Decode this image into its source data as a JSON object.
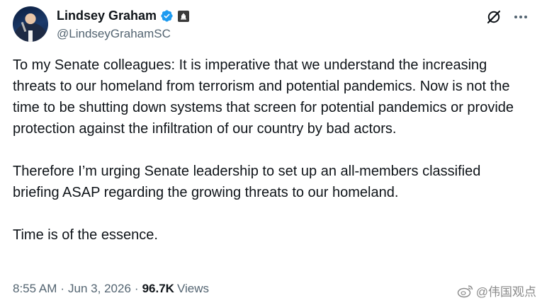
{
  "author": {
    "display_name": "Lindsey Graham",
    "handle": "@LindseyGrahamSC",
    "avatar_icon": "profile-photo",
    "verified_icon": "verified-badge-icon",
    "affiliation_icon": "government-badge-icon"
  },
  "actions": {
    "grok_icon": "grok-icon",
    "more_icon": "more-options-icon"
  },
  "post": {
    "paragraphs": [
      "To my Senate colleagues: It is imperative that we understand the increasing threats to our homeland from terrorism and potential pandemics. Now is not the time to be shutting down systems that screen for potential pandemics or provide protection against the infiltration of our country by bad actors.",
      "Therefore I’m urging Senate leadership to set up an all-members classified briefing ASAP regarding the growing threats to our homeland.",
      "Time is of the essence."
    ]
  },
  "meta": {
    "time": "8:55 AM",
    "separator": "·",
    "date": "Jun 3, 2026",
    "views_count": "96.7K",
    "views_label": "Views"
  },
  "watermark": {
    "text": "@伟国观点",
    "icon": "weibo-icon"
  },
  "colors": {
    "verified_blue": "#1d9bf0",
    "secondary_text": "#536471",
    "primary_text": "#0f1419"
  }
}
